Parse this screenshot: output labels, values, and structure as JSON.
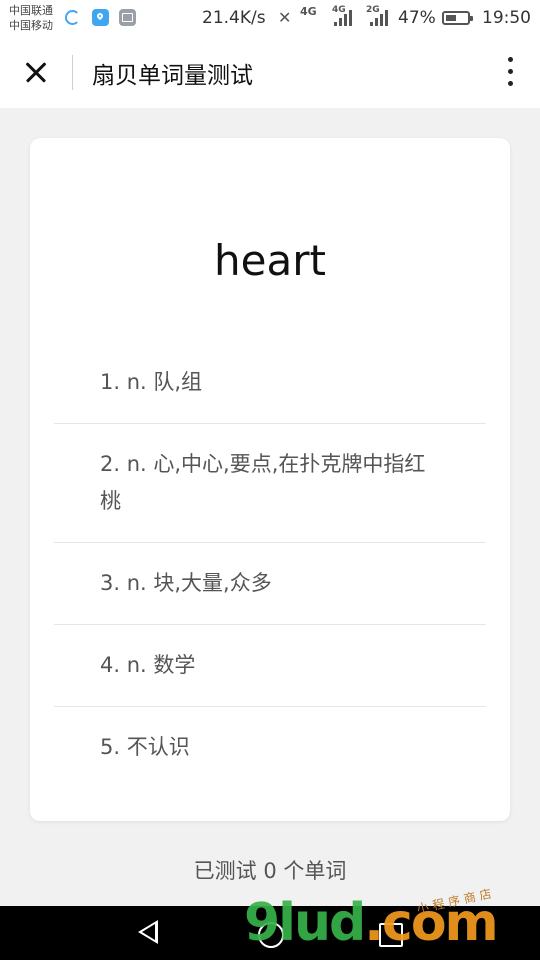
{
  "status_bar": {
    "carrier_1": "中国联通",
    "carrier_2": "中国移动",
    "net_speed": "21.4K/s",
    "net_4g_a": "4G",
    "net_4g_b": "4G",
    "net_2g": "2G",
    "battery": "47%",
    "time": "19:50"
  },
  "titlebar": {
    "title": "扇贝单词量测试"
  },
  "quiz": {
    "word": "heart",
    "options": [
      "1. n. 队,组",
      "2. n. 心,中心,要点,在扑克牌中指红桃",
      "3. n. 块,大量,众多",
      "4. n. 数学",
      "5. 不认识"
    ],
    "progress": "已测试 0 个单词"
  },
  "watermark": {
    "brand": "9lud",
    "suffix": ".com",
    "tag": "小程序商店"
  },
  "colors": {
    "background": "#f1f1f1",
    "card": "#ffffff",
    "option_text": "#555555",
    "watermark_green": "#38b24a",
    "watermark_orange": "#f29a1e"
  }
}
